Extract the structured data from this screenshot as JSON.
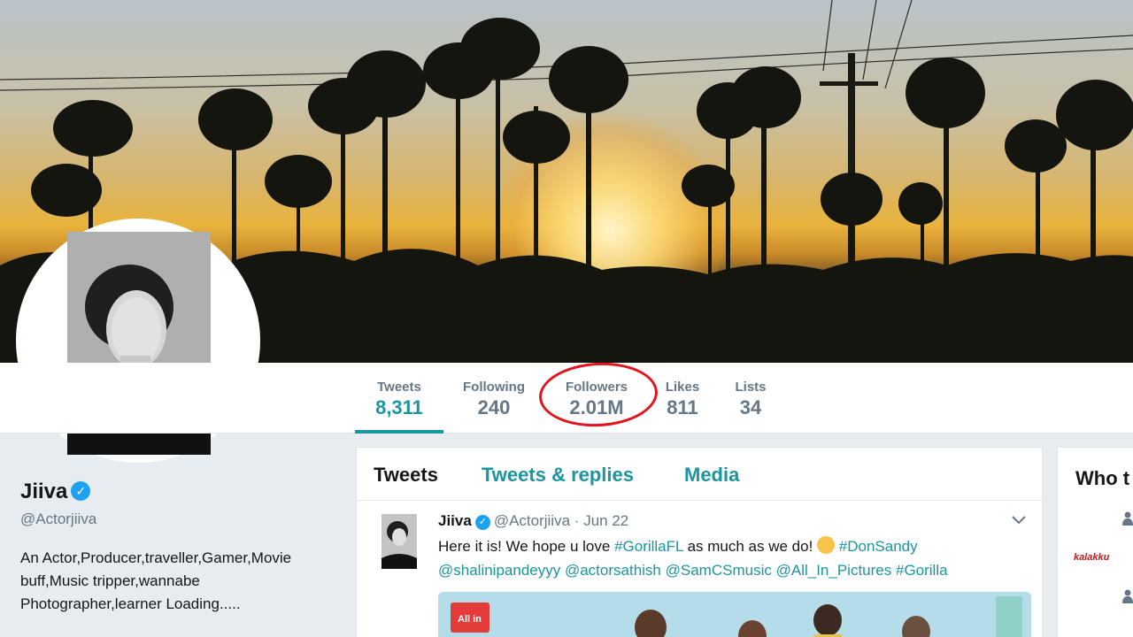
{
  "profile": {
    "name": "Jiiva",
    "handle": "@Actorjiiva",
    "bio": "An Actor,Producer,traveller,Gamer,Movie buff,Music tripper,wannabe Photographer,learner Loading....."
  },
  "stats": [
    {
      "label": "Tweets",
      "value": "8,311",
      "active": true
    },
    {
      "label": "Following",
      "value": "240"
    },
    {
      "label": "Followers",
      "value": "2.01M",
      "highlighted": true
    },
    {
      "label": "Likes",
      "value": "811"
    },
    {
      "label": "Lists",
      "value": "34"
    }
  ],
  "tabs": [
    "Tweets",
    "Tweets & replies",
    "Media"
  ],
  "tweet": {
    "name": "Jiiva",
    "handle": "@Actorjiiva",
    "separator": "·",
    "date": "Jun 22",
    "text_1": "Here it is! We hope u love ",
    "hashtag_1": "#GorillaFL",
    "text_2": " as much as we do! ",
    "hashtag_2": "#DonSandy",
    "mention_1": "@shalinipandeyyy",
    "mention_2": "@actorsathish",
    "mention_3": "@SamCSmusic",
    "mention_4": "@All_In_Pictures",
    "hashtag_3": "#Gorilla",
    "media_logo": "All in"
  },
  "sidebar": {
    "who_title": "Who t",
    "logo_text": "kalakku"
  },
  "colors": {
    "accent": "#1b95a0",
    "verified": "#1da1f2",
    "highlight_circle": "#e3141c"
  },
  "icons": [
    "verified-badge-icon",
    "chevron-down-icon",
    "person-icon"
  ]
}
